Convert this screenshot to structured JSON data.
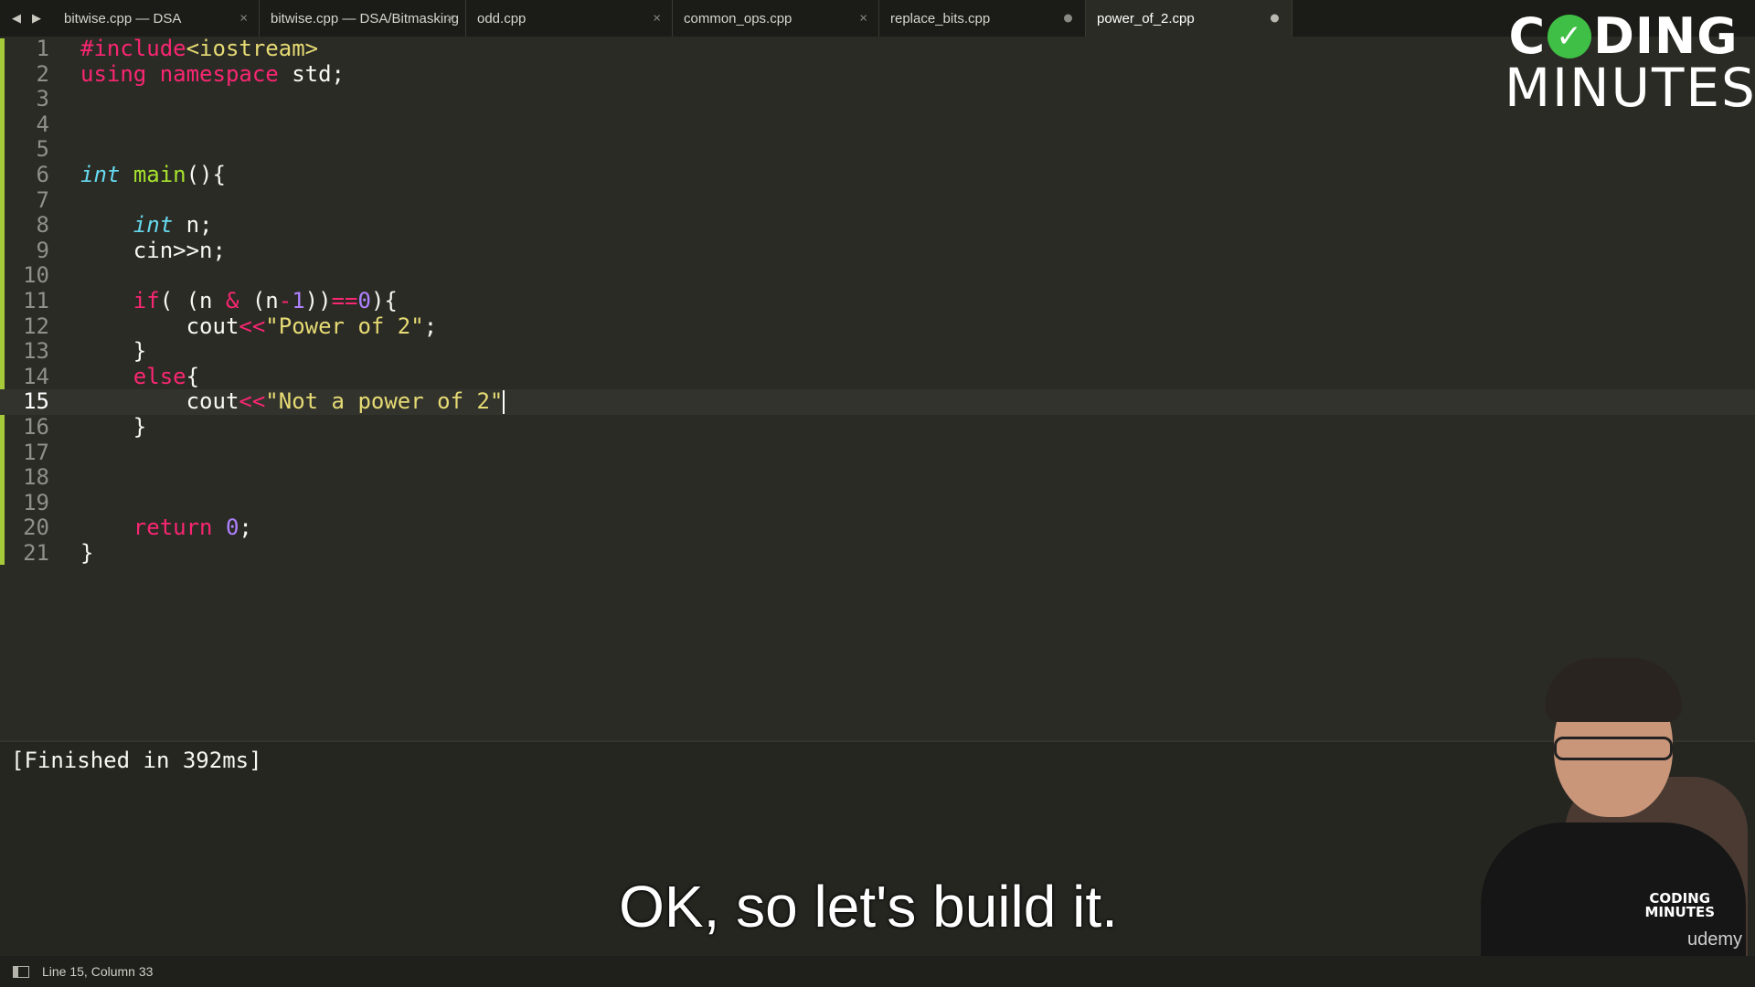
{
  "tabs": [
    {
      "label": "bitwise.cpp — DSA",
      "state": "close"
    },
    {
      "label": "bitwise.cpp — DSA/Bitmasking",
      "state": "close"
    },
    {
      "label": "odd.cpp",
      "state": "close"
    },
    {
      "label": "common_ops.cpp",
      "state": "close"
    },
    {
      "label": "replace_bits.cpp",
      "state": "dirty"
    },
    {
      "label": "power_of_2.cpp",
      "state": "dirty",
      "active": true
    }
  ],
  "nav": {
    "back": "◀",
    "forward": "▶"
  },
  "logo": {
    "line1_pre": "C",
    "line1_post": "DING",
    "line2": "MINUTES",
    "check_icon": "check-icon"
  },
  "editor": {
    "current_line": 15,
    "lines": [
      {
        "n": "1",
        "tokens": [
          {
            "t": "#include",
            "c": "kw"
          },
          {
            "t": "<iostream>",
            "c": "str"
          }
        ]
      },
      {
        "n": "2",
        "tokens": [
          {
            "t": "using",
            "c": "kw"
          },
          {
            "t": " ",
            "c": ""
          },
          {
            "t": "namespace",
            "c": "kw"
          },
          {
            "t": " std;",
            "c": ""
          }
        ]
      },
      {
        "n": "3",
        "tokens": []
      },
      {
        "n": "4",
        "tokens": []
      },
      {
        "n": "5",
        "tokens": []
      },
      {
        "n": "6",
        "tokens": [
          {
            "t": "int",
            "c": "ty"
          },
          {
            "t": " ",
            "c": ""
          },
          {
            "t": "main",
            "c": "fn"
          },
          {
            "t": "(){",
            "c": ""
          }
        ]
      },
      {
        "n": "7",
        "tokens": []
      },
      {
        "n": "8",
        "tokens": [
          {
            "t": "    ",
            "c": ""
          },
          {
            "t": "int",
            "c": "ty"
          },
          {
            "t": " n;",
            "c": ""
          }
        ]
      },
      {
        "n": "9",
        "tokens": [
          {
            "t": "    cin>>n;",
            "c": ""
          }
        ]
      },
      {
        "n": "10",
        "tokens": []
      },
      {
        "n": "11",
        "tokens": [
          {
            "t": "    ",
            "c": ""
          },
          {
            "t": "if",
            "c": "kw"
          },
          {
            "t": "( (n ",
            "c": ""
          },
          {
            "t": "&",
            "c": "kw"
          },
          {
            "t": " (n",
            "c": ""
          },
          {
            "t": "-",
            "c": "kw"
          },
          {
            "t": "1",
            "c": "num"
          },
          {
            "t": "))",
            "c": ""
          },
          {
            "t": "==",
            "c": "kw"
          },
          {
            "t": "0",
            "c": "num"
          },
          {
            "t": "){",
            "c": ""
          }
        ]
      },
      {
        "n": "12",
        "tokens": [
          {
            "t": "        cout",
            "c": ""
          },
          {
            "t": "<<",
            "c": "kw"
          },
          {
            "t": "\"Power of 2\"",
            "c": "str"
          },
          {
            "t": ";",
            "c": ""
          }
        ]
      },
      {
        "n": "13",
        "tokens": [
          {
            "t": "    }",
            "c": ""
          }
        ]
      },
      {
        "n": "14",
        "tokens": [
          {
            "t": "    ",
            "c": ""
          },
          {
            "t": "else",
            "c": "kw"
          },
          {
            "t": "{",
            "c": ""
          }
        ]
      },
      {
        "n": "15",
        "tokens": [
          {
            "t": "        cout",
            "c": ""
          },
          {
            "t": "<<",
            "c": "kw"
          },
          {
            "t": "\"Not a power of 2\"",
            "c": "str"
          }
        ],
        "cursor": true
      },
      {
        "n": "16",
        "tokens": [
          {
            "t": "    }",
            "c": ""
          }
        ]
      },
      {
        "n": "17",
        "tokens": []
      },
      {
        "n": "18",
        "tokens": []
      },
      {
        "n": "19",
        "tokens": []
      },
      {
        "n": "20",
        "tokens": [
          {
            "t": "    ",
            "c": ""
          },
          {
            "t": "return",
            "c": "kw"
          },
          {
            "t": " ",
            "c": ""
          },
          {
            "t": "0",
            "c": "num"
          },
          {
            "t": ";",
            "c": ""
          }
        ]
      },
      {
        "n": "21",
        "tokens": [
          {
            "t": "}",
            "c": ""
          }
        ]
      }
    ]
  },
  "output": {
    "text": "[Finished in 392ms]"
  },
  "status": {
    "position": "Line 15, Column 33",
    "panel_icon": "panel-toggle-icon"
  },
  "subtitle": "OK, so let's build it.",
  "overlay": {
    "badge_line1": "CODING",
    "badge_line2": "MINUTES",
    "brand": "udemy"
  },
  "colors": {
    "background": "#2b2b25",
    "keyword": "#f92672",
    "type": "#66d9ef",
    "function": "#a6e22e",
    "number": "#ae81ff",
    "string": "#e6db74",
    "gutter_marker": "#a6c93a"
  }
}
